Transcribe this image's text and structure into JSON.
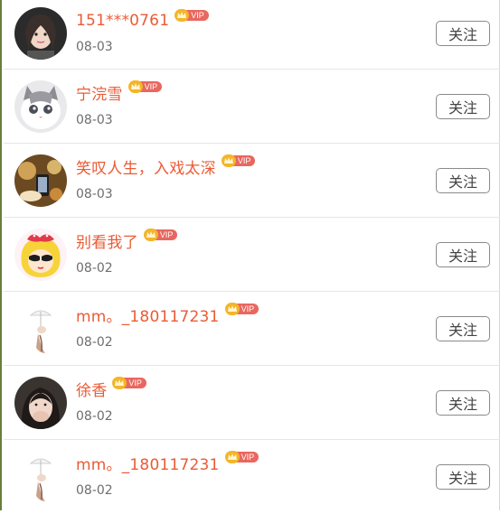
{
  "follow_list": [
    {
      "name": "151***0761",
      "vip": "VIP",
      "date": "08-03",
      "follow_label": "关注",
      "avatar": "girl-portrait"
    },
    {
      "name": "宁浣雪",
      "vip": "VIP",
      "date": "08-03",
      "follow_label": "关注",
      "avatar": "cat-face"
    },
    {
      "name": "笑叹人生，入戏太深",
      "vip": "VIP",
      "date": "08-03",
      "follow_label": "关注",
      "avatar": "warm-room-photo"
    },
    {
      "name": "别看我了",
      "vip": "VIP",
      "date": "08-02",
      "follow_label": "关注",
      "avatar": "cartoon-girl-with-sunglasses"
    },
    {
      "name": "mm。_180117231",
      "vip": "VIP",
      "date": "08-02",
      "follow_label": "关注",
      "avatar": "umbrella-figure"
    },
    {
      "name": "徐香",
      "vip": "VIP",
      "date": "08-02",
      "follow_label": "关注",
      "avatar": "woman-covering-face"
    },
    {
      "name": "mm。_180117231",
      "vip": "VIP",
      "date": "08-02",
      "follow_label": "关注",
      "avatar": "umbrella-figure"
    }
  ],
  "colors": {
    "name": "#ea5b36",
    "vip_badge": "#e9675f",
    "vip_crown": "#f4b529",
    "date": "#6e6e6e",
    "divider": "#e6e6e6"
  }
}
